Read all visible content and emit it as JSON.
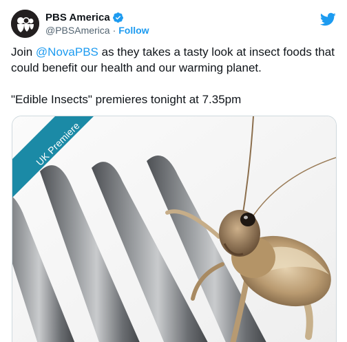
{
  "account": {
    "display_name": "PBS America",
    "handle": "@PBSAmerica",
    "separator": "·",
    "follow_label": "Follow"
  },
  "tweet": {
    "text_join": "Join ",
    "mention": "@NovaPBS",
    "text_rest": " as they takes a tasty look at insect foods that could benefit our health and our warming planet.",
    "premiere_line": "\"Edible Insects\" premieres tonight at 7.35pm"
  },
  "media": {
    "banner_label": "UK Premiere",
    "icon": "cricket-on-fork-photo"
  },
  "icons": {
    "avatar": "pbs-logo-icon",
    "verified": "verified-badge-icon",
    "brand": "twitter-bird-icon"
  },
  "colors": {
    "accent": "#1d9bf0",
    "banner": "#1b8aa6",
    "text": "#0f1419",
    "secondary": "#536471"
  }
}
